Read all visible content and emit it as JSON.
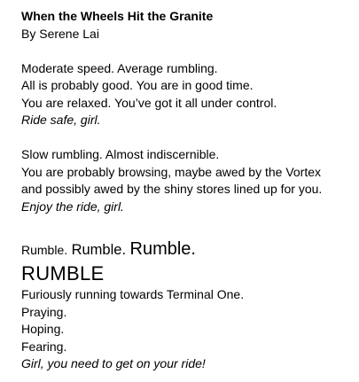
{
  "document": {
    "title": "When the Wheels Hit the Granite",
    "byline": "By Serene Lai",
    "stanza1": [
      "Moderate speed. Average rumbling.",
      "All is probably good. You are in good time.",
      "You are relaxed. You’ve got it all under control."
    ],
    "stanza1_closing": "Ride safe, girl.",
    "stanza2": [
      "Slow rumbling. Almost indiscernible.",
      "You are probably browsing, maybe awed by the Vortex",
      "and possibly awed by the shiny stores lined up for you."
    ],
    "stanza2_closing": "Enjoy the ride, girl.",
    "rumbles": [
      "Rumble.",
      "Rumble.",
      "Rumble."
    ],
    "rumble_big": "RUMBLE",
    "stanza3": [
      "Furiously running towards Terminal One.",
      "Praying.",
      "Hoping.",
      "Fearing."
    ],
    "stanza3_closing": "Girl, you need to get on your ride!"
  }
}
